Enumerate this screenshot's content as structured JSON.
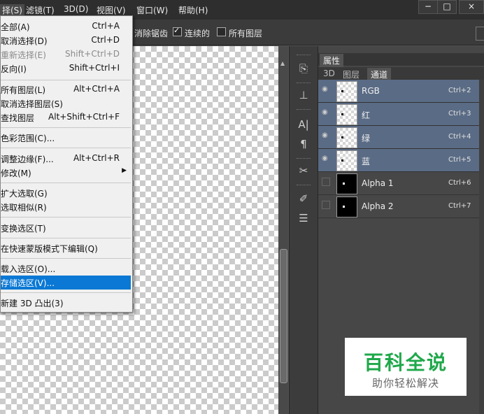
{
  "menubar": {
    "items": [
      "择(S)",
      "滤镜(T)",
      "3D(D)",
      "视图(V)",
      "窗口(W)",
      "帮助(H)"
    ],
    "minimize": "−",
    "maximize": "□",
    "close": "×"
  },
  "options": {
    "antialias_label": "消除锯齿",
    "contiguous_label": "连续的",
    "contiguous_checked": true,
    "all_layers_label": "所有图层",
    "all_layers_checked": false
  },
  "select_menu": {
    "items": [
      {
        "label": "全部(A)",
        "shortcut": "Ctrl+A"
      },
      {
        "label": "取消选择(D)",
        "shortcut": "Ctrl+D"
      },
      {
        "label": "重新选择(E)",
        "shortcut": "Shift+Ctrl+D",
        "disabled": true
      },
      {
        "label": "反向(I)",
        "shortcut": "Shift+Ctrl+I"
      },
      {
        "label": "所有图层(L)",
        "shortcut": "Alt+Ctrl+A"
      },
      {
        "label": "取消选择图层(S)",
        "shortcut": ""
      },
      {
        "label": "查找图层",
        "shortcut": "Alt+Shift+Ctrl+F"
      },
      {
        "label": "色彩范围(C)...",
        "shortcut": ""
      },
      {
        "label": "调整边缘(F)...",
        "shortcut": "Alt+Ctrl+R"
      },
      {
        "label": "修改(M)",
        "shortcut": "",
        "submenu": true
      },
      {
        "label": "扩大选取(G)",
        "shortcut": ""
      },
      {
        "label": "选取相似(R)",
        "shortcut": ""
      },
      {
        "label": "变换选区(T)",
        "shortcut": ""
      },
      {
        "label": "在快速蒙版模式下编辑(Q)",
        "shortcut": ""
      },
      {
        "label": "载入选区(O)...",
        "shortcut": ""
      },
      {
        "label": "存储选区(V)...",
        "shortcut": "",
        "highlighted": true
      },
      {
        "label": "新建 3D 凸出(3)",
        "shortcut": ""
      }
    ]
  },
  "panel": {
    "tab_properties": "属性",
    "tab_3d": "3D",
    "tab_layers": "图层",
    "tab_channels": "通道",
    "channels": [
      {
        "name": "RGB",
        "shortcut": "Ctrl+2",
        "visible": true
      },
      {
        "name": "红",
        "shortcut": "Ctrl+3",
        "visible": true
      },
      {
        "name": "绿",
        "shortcut": "Ctrl+4",
        "visible": true
      },
      {
        "name": "蓝",
        "shortcut": "Ctrl+5",
        "visible": true
      },
      {
        "name": "Alpha 1",
        "shortcut": "Ctrl+6",
        "visible": false
      },
      {
        "name": "Alpha 2",
        "shortcut": "Ctrl+7",
        "visible": false
      }
    ]
  },
  "watermark": {
    "title": "百科全说",
    "subtitle": "助你轻松解决"
  }
}
